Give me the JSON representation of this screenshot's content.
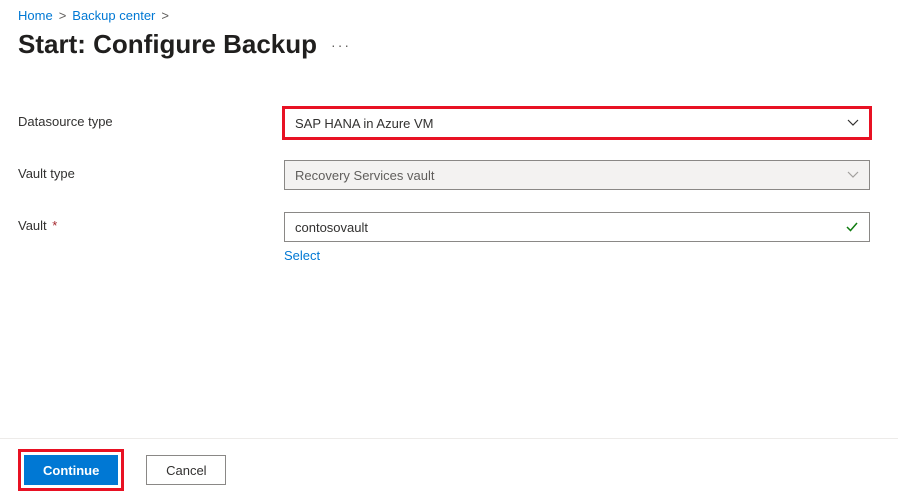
{
  "breadcrumb": {
    "home": "Home",
    "backup_center": "Backup center",
    "sep": ">"
  },
  "page": {
    "title": "Start: Configure Backup",
    "more": "···"
  },
  "fields": {
    "datasource": {
      "label": "Datasource type",
      "value": "SAP HANA in Azure VM"
    },
    "vault_type": {
      "label": "Vault type",
      "value": "Recovery Services vault"
    },
    "vault": {
      "label": "Vault",
      "required": "*",
      "value": "contosovault",
      "select_link": "Select"
    }
  },
  "footer": {
    "continue": "Continue",
    "cancel": "Cancel"
  }
}
